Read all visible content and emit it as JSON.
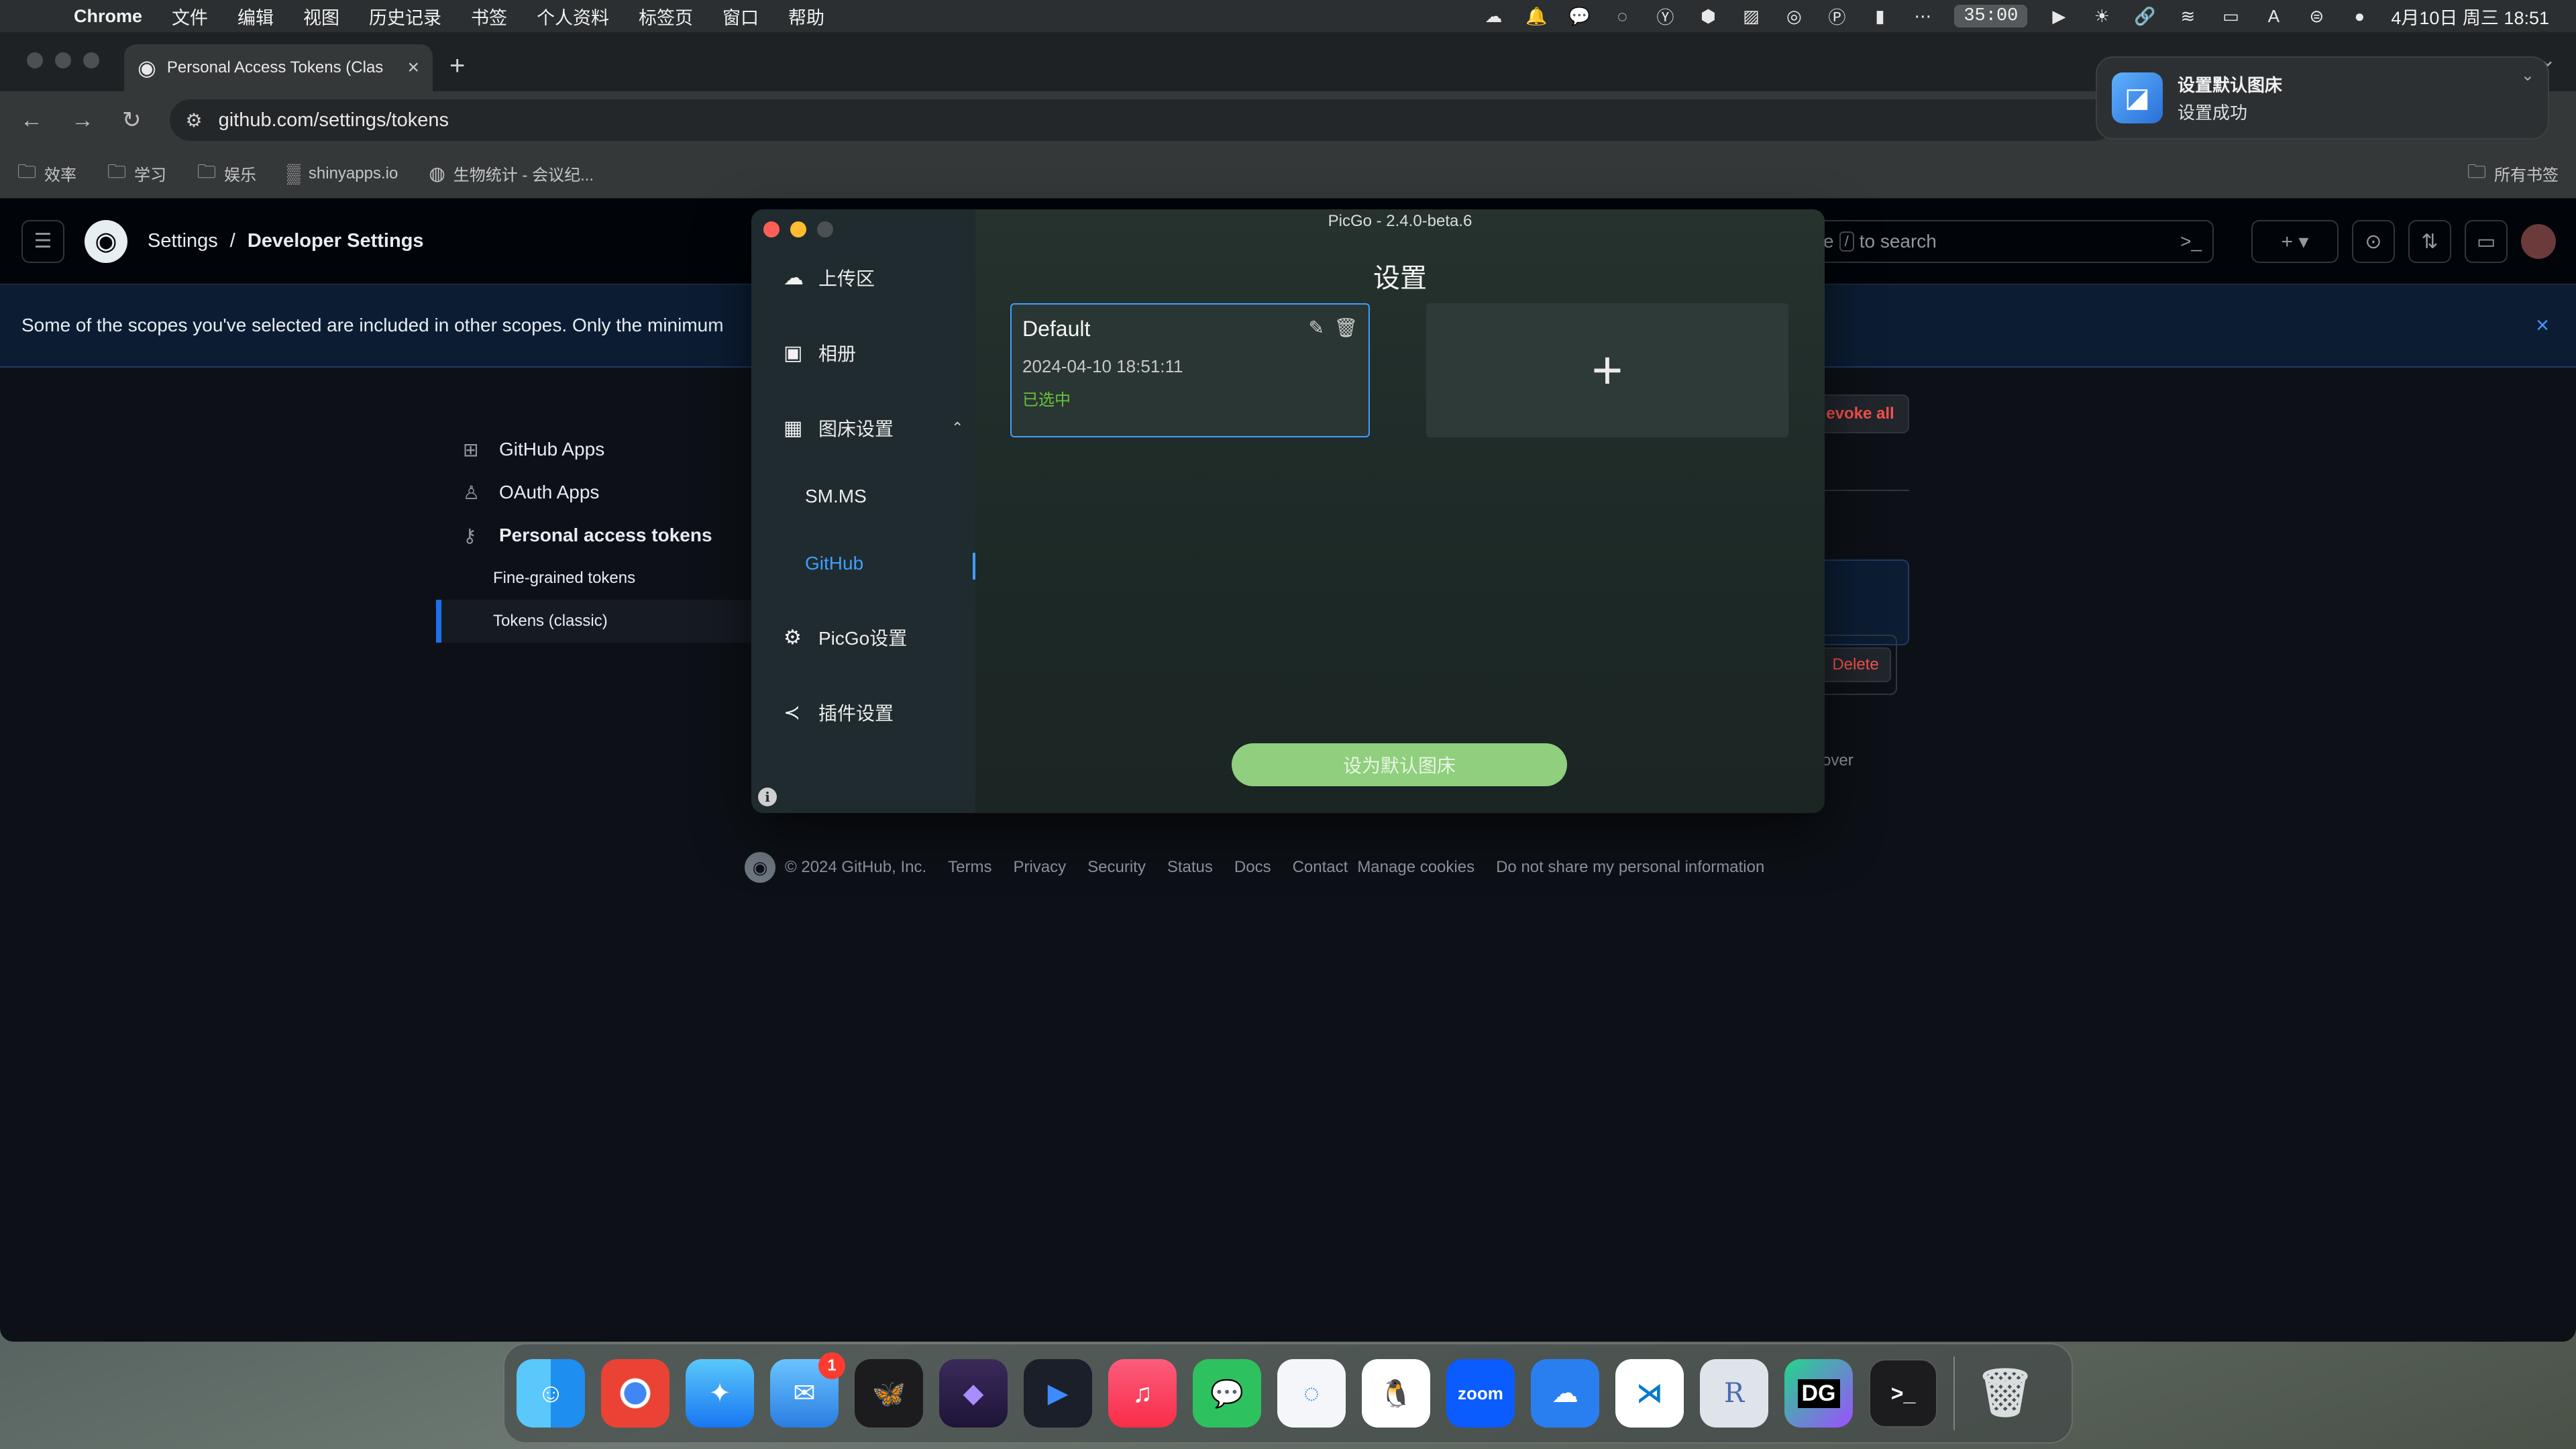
{
  "menubar": {
    "app_name": "Chrome",
    "menus": [
      "文件",
      "编辑",
      "视图",
      "历史记录",
      "书签",
      "个人资料",
      "标签页",
      "窗口",
      "帮助"
    ],
    "timer": "35:00",
    "datetime": "4月10日 周三  18:51"
  },
  "browser": {
    "tab_title": "Personal Access Tokens (Clas",
    "url": "github.com/settings/tokens",
    "bookmarks": [
      "效率",
      "学习",
      "娱乐",
      "shinyapps.io",
      "生物统计 - 会议纪..."
    ],
    "all_bookmarks": "所有书签"
  },
  "github": {
    "crumb_settings": "Settings",
    "crumb_sep": "/",
    "crumb_dev": "Developer Settings",
    "search_prefix": "e",
    "search_key": "/",
    "search_suffix": "to search",
    "flash": "Some of the scopes you've selected are included in other scopes. Only the minimum",
    "sidebar": {
      "github_apps": "GitHub Apps",
      "oauth_apps": "OAuth Apps",
      "pat": "Personal access tokens",
      "fine_grained": "Fine-grained tokens",
      "classic": "Tokens (classic)"
    },
    "revoke": "evoke all",
    "delete": "Delete",
    "over": "over",
    "footer": {
      "copyright": "© 2024 GitHub, Inc.",
      "links": [
        "Terms",
        "Privacy",
        "Security",
        "Status",
        "Docs",
        "Contact",
        "Manage cookies",
        "Do not share my personal information"
      ]
    }
  },
  "picgo": {
    "window_title": "PicGo - 2.4.0-beta.6",
    "heading": "设置",
    "nav": {
      "upload": "上传区",
      "album": "相册",
      "bed_settings": "图床设置",
      "smms": "SM.MS",
      "github": "GitHub",
      "picgo_settings": "PicGo设置",
      "plugin_settings": "插件设置"
    },
    "card": {
      "name": "Default",
      "date": "2024-04-10 18:51:11",
      "status": "已选中"
    },
    "default_button": "设为默认图床"
  },
  "notification": {
    "title": "设置默认图床",
    "body": "设置成功"
  },
  "dock": {
    "mail_badge": "1",
    "zoom_label": "zoom",
    "r_label": "R",
    "dg_label": "DG"
  }
}
